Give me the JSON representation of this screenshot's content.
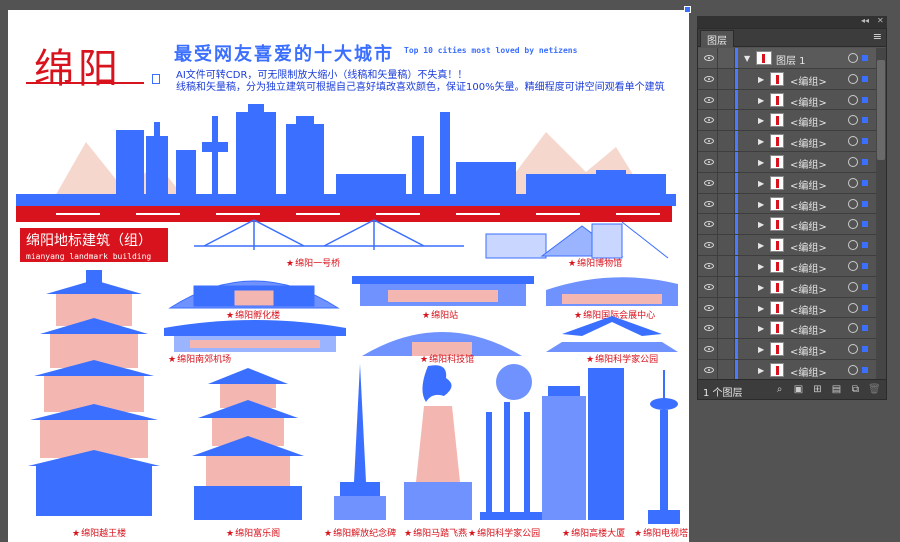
{
  "artboard": {
    "brand": "绵阳",
    "headline": "最受网友喜爱的十大城市",
    "subheadline": "Top 10 cities most loved by netizens",
    "desc_line1": "AI文件可转CDR，可无限制放大缩小（线稿和矢量稿）不失真！！",
    "desc_line2": "线稿和矢量稿，分为独立建筑可根据自己喜好填改喜欢颜色，保证100%矢量。精细程度可讲空间观看单个建筑",
    "section_title": "绵阳地标建筑（组）",
    "section_subtitle": "mianyang landmark building (1)",
    "labels": {
      "bridge": "绵阳一号桥",
      "museum": "绵阳博物馆",
      "incubator": "绵阳孵化楼",
      "station": "绵阳站",
      "convention": "绵阳国际会展中心",
      "airport": "绵阳南郊机场",
      "techhall": "绵阳科技馆",
      "scientist_park": "绵阳科学家公园",
      "yuewang": "绵阳越王楼",
      "fule": "绵阳富乐阁",
      "monument": "绵阳解放纪念碑",
      "horse": "绵阳马踏飞燕",
      "sci_park2": "绵阳科学家公园",
      "tower": "绵阳高楼大厦",
      "tvtower": "绵阳电视塔"
    },
    "colors": {
      "blue": "#3b6fff",
      "red": "#d8131d",
      "pink": "#f4b6b0"
    }
  },
  "layers_panel": {
    "tab_label": "图层",
    "menu_icon": "menu-icon",
    "top_layer": "图层 1",
    "group_label": "<编组>",
    "group_count": 15,
    "footer_count": "1 个图层",
    "accent_color": "#4a7bff"
  }
}
